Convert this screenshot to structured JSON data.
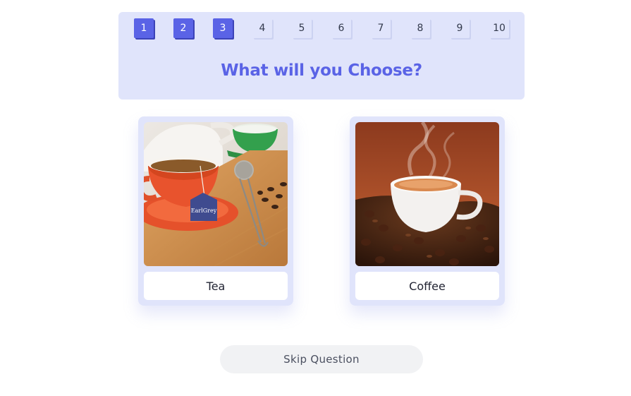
{
  "progress": {
    "steps": [
      "1",
      "2",
      "3",
      "4",
      "5",
      "6",
      "7",
      "8",
      "9",
      "10"
    ],
    "completed_count": 3
  },
  "question": {
    "title": "What will you Choose?"
  },
  "options": [
    {
      "label": "Tea",
      "image": "tea-cup-photo",
      "image_text": "EarlGrey"
    },
    {
      "label": "Coffee",
      "image": "coffee-cup-photo"
    }
  ],
  "actions": {
    "skip_label": "Skip Question"
  },
  "colors": {
    "accent": "#5a63e6",
    "panel": "#e0e4fb",
    "skip_bg": "#f1f2f4"
  }
}
